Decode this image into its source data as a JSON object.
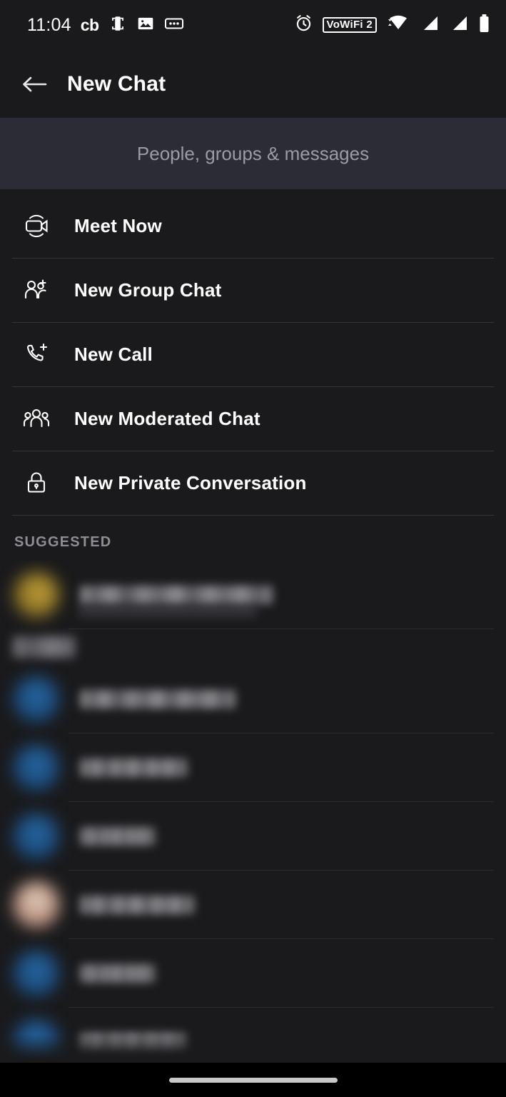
{
  "status_bar": {
    "time": "11:04",
    "left_icons": [
      {
        "name": "cb-notification-icon",
        "label": "cb"
      },
      {
        "name": "device-cast-icon",
        "label": ""
      },
      {
        "name": "photo-icon",
        "label": ""
      },
      {
        "name": "voicemail-icon",
        "label": ""
      }
    ],
    "right_icons": [
      {
        "name": "alarm-icon",
        "label": ""
      },
      {
        "name": "vowifi-icon",
        "label": "VoWiFi 2"
      },
      {
        "name": "wifi-icon",
        "label": ""
      },
      {
        "name": "cellular-signal-1-icon",
        "label": ""
      },
      {
        "name": "cellular-signal-2-icon",
        "label": ""
      },
      {
        "name": "battery-icon",
        "label": ""
      }
    ]
  },
  "app_bar": {
    "back_label": "Back",
    "title": "New Chat"
  },
  "search": {
    "placeholder": "People, groups & messages",
    "value": "",
    "background": "#2c2c37"
  },
  "actions": [
    {
      "icon": "video-camera-icon",
      "label": "Meet Now"
    },
    {
      "icon": "people-add-icon",
      "label": "New Group Chat"
    },
    {
      "icon": "phone-add-icon",
      "label": "New Call"
    },
    {
      "icon": "people-group-icon",
      "label": "New Moderated Chat"
    },
    {
      "icon": "lock-icon",
      "label": "New Private Conversation"
    }
  ],
  "suggested": {
    "header": "SUGGESTED",
    "items": [
      {
        "avatar": "photo-gold",
        "name_redacted": true,
        "name_width": 270,
        "has_subtitle": true,
        "sub_width": 250
      },
      {
        "avatar": "group-label",
        "name_redacted": true,
        "name_width": 0,
        "has_subtitle": false,
        "sub_width": 0
      },
      {
        "avatar": "blue",
        "name_redacted": true,
        "name_width": 218,
        "has_subtitle": false,
        "sub_width": 0
      },
      {
        "avatar": "blue",
        "name_redacted": true,
        "name_width": 150,
        "has_subtitle": false,
        "sub_width": 0
      },
      {
        "avatar": "blue",
        "name_redacted": true,
        "name_width": 105,
        "has_subtitle": false,
        "sub_width": 0
      },
      {
        "avatar": "photo-skin",
        "name_redacted": true,
        "name_width": 160,
        "has_subtitle": false,
        "sub_width": 0
      },
      {
        "avatar": "blue",
        "name_redacted": true,
        "name_width": 105,
        "has_subtitle": false,
        "sub_width": 0
      },
      {
        "avatar": "blue",
        "name_redacted": true,
        "name_width": 148,
        "has_subtitle": false,
        "sub_width": 0
      }
    ]
  },
  "nav_bar": {
    "gesture_pill": "home-gesture-bar"
  },
  "colors": {
    "background": "#1a1a1c",
    "search_background": "#2c2c37",
    "divider": "#34343a",
    "text_primary": "#ffffff",
    "text_secondary": "#8d8d94",
    "placeholder": "#9b9ba5"
  }
}
